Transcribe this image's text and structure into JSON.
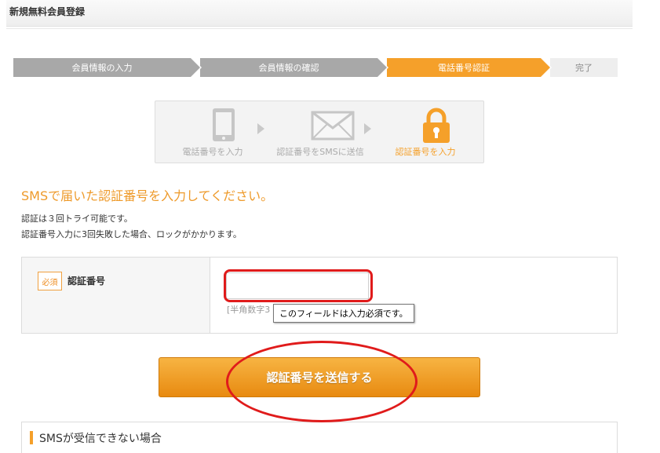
{
  "header": {
    "title": "新規無料会員登録"
  },
  "steps": [
    {
      "label": "会員情報の入力",
      "state": "done"
    },
    {
      "label": "会員情報の確認",
      "state": "done"
    },
    {
      "label": "電話番号認証",
      "state": "active"
    },
    {
      "label": "完了",
      "state": "todo"
    }
  ],
  "flow": {
    "items": [
      {
        "label": "電話番号を入力",
        "icon": "phone-icon"
      },
      {
        "label": "認証番号をSMSに送信",
        "icon": "envelope-icon"
      },
      {
        "label": "認証番号を入力",
        "icon": "lock-icon"
      }
    ]
  },
  "main": {
    "heading": "SMSで届いた認証番号を入力してください。",
    "note1": "認証は３回トライ可能です。",
    "note2": "認証番号入力に3回失敗した場合、ロックがかかります。"
  },
  "form": {
    "required_badge": "必須",
    "field_label": "認証番号",
    "input_value": "",
    "hint": "[半角数字3",
    "tooltip": "このフィールドは入力必須です。"
  },
  "submit": {
    "label": "認証番号を送信する"
  },
  "section": {
    "title": "SMSが受信できない場合"
  },
  "colors": {
    "accent": "#f5a02a",
    "annotation": "#e01b1b",
    "step_done": "#a8a8a8"
  }
}
